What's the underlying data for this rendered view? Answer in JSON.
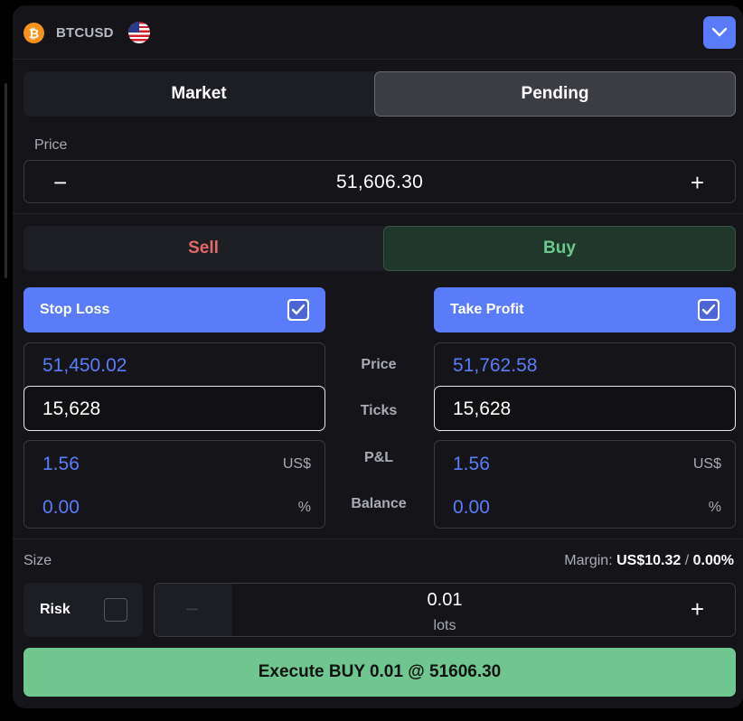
{
  "header": {
    "symbol": "BTCUSD",
    "coin_icon": "bitcoin-icon",
    "flag_icon": "us-flag-icon",
    "dropdown_icon": "chevron-down-icon",
    "accent_color": "#5b7cfa"
  },
  "order_type_tabs": {
    "market": "Market",
    "pending": "Pending",
    "active": "Pending"
  },
  "price": {
    "label": "Price",
    "value": "51,606.30",
    "minus": "−",
    "plus": "+"
  },
  "side_tabs": {
    "sell": "Sell",
    "buy": "Buy",
    "active": "Buy",
    "sell_color": "#e06a6a",
    "buy_color": "#6cc98d"
  },
  "stop_loss": {
    "label": "Stop Loss",
    "checked": true,
    "price": "51,450.02",
    "ticks": "15,628",
    "pnl": "1.56",
    "pnl_unit": "US$",
    "balance": "0.00",
    "balance_unit": "%"
  },
  "take_profit": {
    "label": "Take Profit",
    "checked": true,
    "price": "51,762.58",
    "ticks": "15,628",
    "pnl": "1.56",
    "pnl_unit": "US$",
    "balance": "0.00",
    "balance_unit": "%"
  },
  "row_labels": {
    "price": "Price",
    "ticks": "Ticks",
    "pnl": "P&L",
    "balance": "Balance"
  },
  "size": {
    "label": "Size",
    "margin_label": "Margin:",
    "margin_value": "US$10.32",
    "margin_sep": "/",
    "margin_percent": "0.00%",
    "risk_label": "Risk",
    "risk_checked": false,
    "lots_value": "0.01",
    "lots_unit": "lots",
    "minus": "−",
    "plus": "+"
  },
  "execute": {
    "label": "Execute BUY 0.01 @ 51606.30",
    "color": "#6fc78f"
  }
}
